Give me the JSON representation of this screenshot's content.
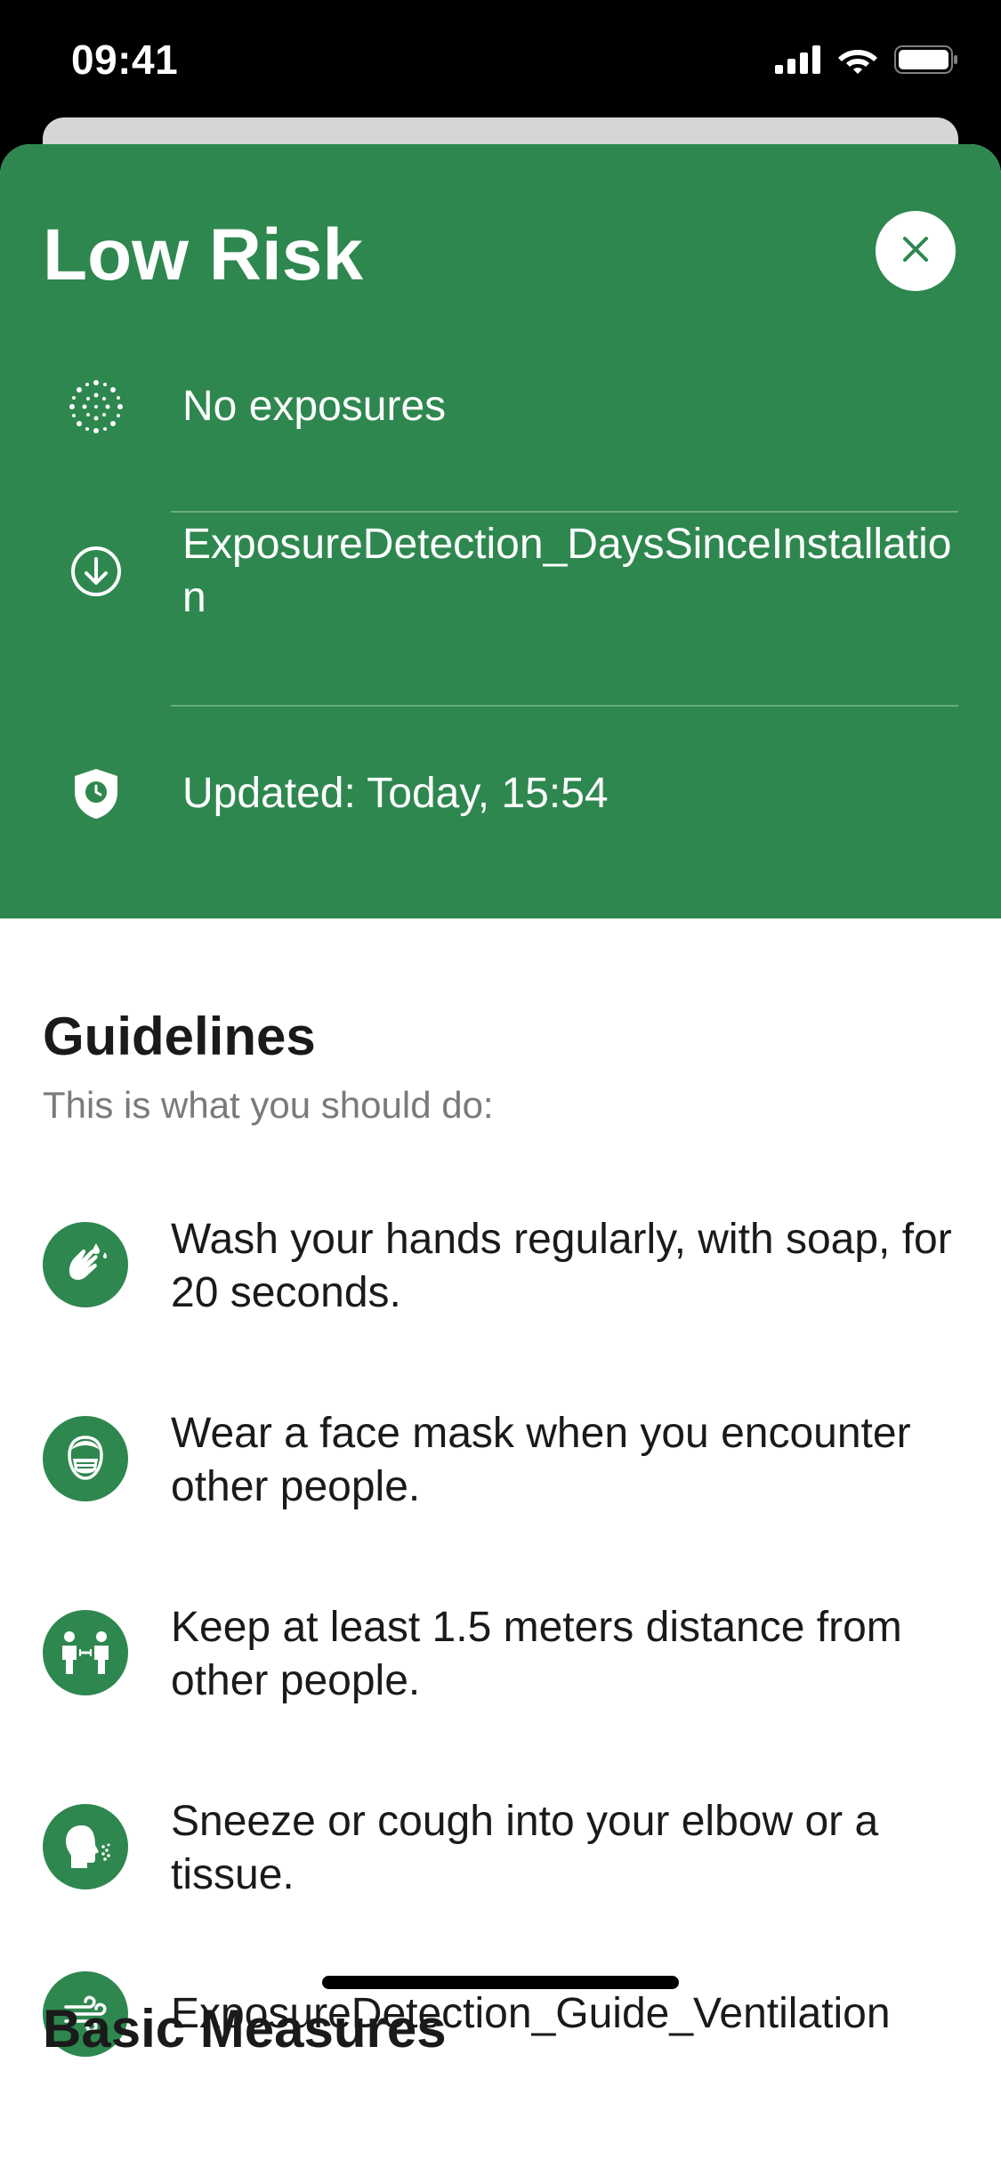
{
  "status_bar": {
    "time": "09:41"
  },
  "header": {
    "title": "Low Risk",
    "background_color": "#2e874f",
    "rows": [
      {
        "icon": "exposures-dots-icon",
        "text": "No exposures"
      },
      {
        "icon": "download-circle-icon",
        "text": "ExposureDetection_DaysSinceInstallation"
      },
      {
        "icon": "shield-clock-icon",
        "text": "Updated: Today, 15:54"
      }
    ]
  },
  "guidelines": {
    "title": "Guidelines",
    "subtitle": "This is what you should do:",
    "items": [
      {
        "icon": "hand-wash-icon",
        "text": "Wash your hands regularly, with soap, for 20 seconds."
      },
      {
        "icon": "face-mask-icon",
        "text": "Wear a face mask when you encounter other people."
      },
      {
        "icon": "distance-icon",
        "text": "Keep at least 1.5 meters distance from other people."
      },
      {
        "icon": "sneeze-icon",
        "text": "Sneeze or cough into your elbow or a tissue."
      },
      {
        "icon": "ventilation-icon",
        "text": "ExposureDetection_Guide_Ventilation"
      }
    ]
  },
  "next_section": {
    "title": "Basic Measures"
  }
}
